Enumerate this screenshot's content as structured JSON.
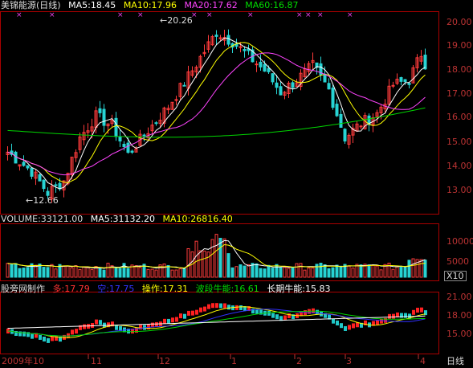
{
  "header": {
    "title": "美锦能源(日线)",
    "ma5": "MA5:18.45",
    "ma10": "MA10:17.96",
    "ma20": "MA20:17.62",
    "ma60": "MA60:16.87"
  },
  "price_axis": [
    "20.00",
    "19.00",
    "18.00",
    "17.00",
    "16.00",
    "15.00",
    "14.00",
    "13.00"
  ],
  "annotations": {
    "high": "20.26",
    "low": "12.66"
  },
  "volume_header": {
    "volume": "VOLUME:33121.00",
    "ma5": "MA5:31132.20",
    "ma10": "MA10:26816.40"
  },
  "volume_axis": [
    "10000",
    "5000"
  ],
  "volume_unit": "X10",
  "indicator_header": {
    "name": "股旁网制作",
    "duo": "多:17.79",
    "kong": "空:17.75",
    "caozuo": "操作:17.31",
    "boduan": "波段牛能:16.61",
    "changqi": "长期牛能:15.83"
  },
  "indicator_axis": [
    "21.00",
    "18.00",
    "15.00"
  ],
  "x_axis": [
    "2009年10",
    "11",
    "12",
    "1",
    "2",
    "3",
    "4"
  ],
  "period_label": "日线",
  "colors": {
    "up": "#ff3b3b",
    "down": "#27d3d3",
    "ma5": "#ffffff",
    "ma10": "#ffff00",
    "ma20": "#ff44ff",
    "ma60": "#00d400",
    "axis": "#bb3333"
  }
}
